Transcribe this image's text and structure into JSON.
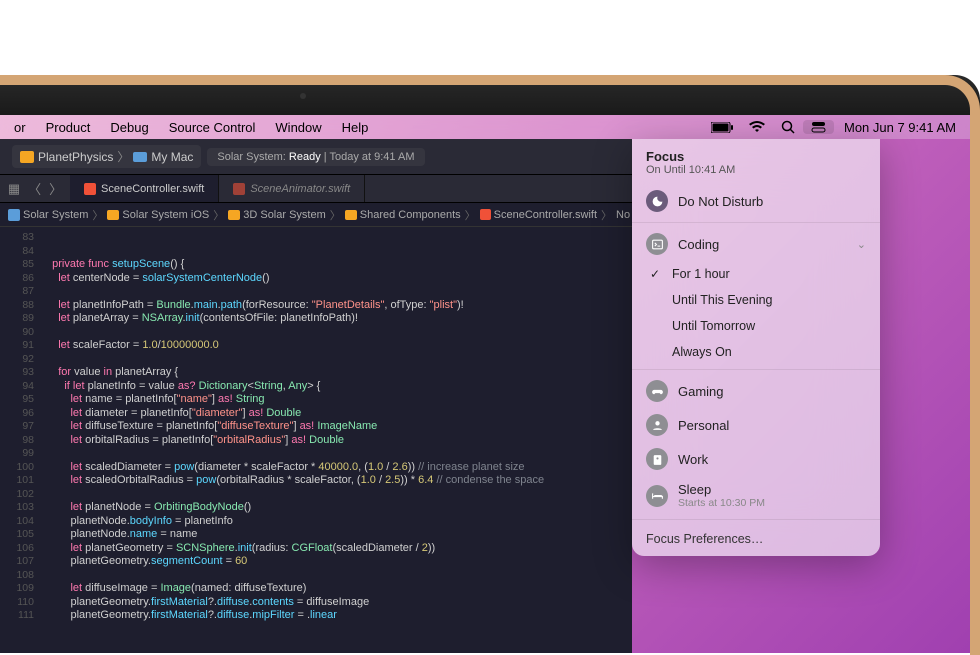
{
  "menubar": {
    "items": [
      "or",
      "Product",
      "Debug",
      "Source Control",
      "Window",
      "Help"
    ],
    "clock": "Mon Jun 7  9:41 AM"
  },
  "xcode": {
    "scheme": "PlanetPhysics",
    "target": "My Mac",
    "status_prefix": "Solar System:",
    "status_state": "Ready",
    "status_time": "| Today at 9:41 AM",
    "tabs": [
      "SceneController.swift",
      "SceneAnimator.swift"
    ],
    "path": [
      "Solar System",
      "Solar System iOS",
      "3D Solar System",
      "Shared Components",
      "SceneController.swift",
      "No Selection"
    ],
    "lines": [
      "83",
      "84",
      "85",
      "86",
      "87",
      "88",
      "89",
      "90",
      "91",
      "92",
      "93",
      "94",
      "95",
      "96",
      "97",
      "98",
      "99",
      "100",
      "101",
      "102",
      "103",
      "104",
      "105",
      "106",
      "107",
      "108",
      "109",
      "110",
      "111"
    ]
  },
  "focus": {
    "title": "Focus",
    "subtitle": "On Until 10:41 AM",
    "dnd": "Do Not Disturb",
    "coding": "Coding",
    "for1hour": "For 1 hour",
    "until_evening": "Until This Evening",
    "until_tomorrow": "Until Tomorrow",
    "always_on": "Always On",
    "gaming": "Gaming",
    "personal": "Personal",
    "work": "Work",
    "sleep": "Sleep",
    "sleep_sub": "Starts at 10:30 PM",
    "prefs": "Focus Preferences…"
  },
  "code": {
    "l84a": "private",
    "l84b": "func",
    "l84c": "setupScene",
    "l84d": "() {",
    "l85a": "let",
    "l85b": "centerNode = ",
    "l85c": "solarSystemCenterNode",
    "l85d": "()",
    "l87a": "let",
    "l87b": "planetInfoPath = ",
    "l87c": "Bundle",
    "l87d": ".",
    "l87e": "main",
    "l87f": ".",
    "l87g": "path",
    "l87h": "(forResource: ",
    "l87i": "\"PlanetDetails\"",
    "l87j": ", ofType: ",
    "l87k": "\"plist\"",
    "l87l": ")!",
    "l88a": "let",
    "l88b": "planetArray = ",
    "l88c": "NSArray",
    "l88d": ".",
    "l88e": "init",
    "l88f": "(contentsOfFile: planetInfoPath)!",
    "l90a": "let",
    "l90b": "scaleFactor = ",
    "l90c": "1.0",
    "l90d": "/",
    "l90e": "10000000.0",
    "l92a": "for",
    "l92b": "value ",
    "l92c": "in",
    "l92d": " planetArray {",
    "l93a": "if",
    "l93b": "let",
    "l93c": "planetInfo = value ",
    "l93d": "as?",
    "l93e": "Dictionary",
    "l93f": "<",
    "l93g": "String",
    "l93h": ", ",
    "l93i": "Any",
    "l93j": "> {",
    "l94a": "let",
    "l94b": "name = planetInfo[",
    "l94c": "\"name\"",
    "l94d": "] ",
    "l94e": "as!",
    "l94f": "String",
    "l95a": "let",
    "l95b": "diameter = planetInfo[",
    "l95c": "\"diameter\"",
    "l95d": "] ",
    "l95e": "as!",
    "l95f": "Double",
    "l96a": "let",
    "l96b": "diffuseTexture = planetInfo[",
    "l96c": "\"diffuseTexture\"",
    "l96d": "] ",
    "l96e": "as!",
    "l96f": "ImageName",
    "l97a": "let",
    "l97b": "orbitalRadius = planetInfo[",
    "l97c": "\"orbitalRadius\"",
    "l97d": "] ",
    "l97e": "as!",
    "l97f": "Double",
    "l100a": "let",
    "l100b": "scaledDiameter = ",
    "l100c": "pow",
    "l100d": "(diameter * scaleFactor * ",
    "l100e": "40000.0",
    "l100f": ", (",
    "l100g": "1.0",
    "l100h": " / ",
    "l100i": "2.6",
    "l100j": ")) ",
    "l100k": "// increase planet size",
    "l101a": "let",
    "l101b": "scaledOrbitalRadius = ",
    "l101c": "pow",
    "l101d": "(orbitalRadius * scaleFactor, (",
    "l101e": "1.0",
    "l101f": " / ",
    "l101g": "2.5",
    "l101h": ")) * ",
    "l101i": "6.4",
    "l101j": "// condense the space",
    "l103a": "let",
    "l103b": "planetNode = ",
    "l103c": "OrbitingBodyNode",
    "l103d": "()",
    "l104a": "planetNode.",
    "l104b": "bodyInfo",
    "l104c": " = planetInfo",
    "l105a": "planetNode.",
    "l105b": "name",
    "l105c": " = name",
    "l106a": "let",
    "l106b": "planetGeometry = ",
    "l106c": "SCNSphere",
    "l106d": ".",
    "l106e": "init",
    "l106f": "(radius: ",
    "l106g": "CGFloat",
    "l106h": "(scaledDiameter / ",
    "l106i": "2",
    "l106j": "))",
    "l107a": "planetGeometry.",
    "l107b": "segmentCount",
    "l107c": " = ",
    "l107d": "60",
    "l109a": "let",
    "l109b": "diffuseImage = ",
    "l109c": "Image",
    "l109d": "(named: diffuseTexture)",
    "l110a": "planetGeometry.",
    "l110b": "firstMaterial",
    "l110c": "?.",
    "l110d": "diffuse",
    "l110e": ".",
    "l110f": "contents",
    "l110g": " = diffuseImage",
    "l111a": "planetGeometry.",
    "l111b": "firstMaterial",
    "l111c": "?.",
    "l111d": "diffuse",
    "l111e": ".",
    "l111f": "mipFilter",
    "l111g": " = .",
    "l111h": "linear"
  }
}
